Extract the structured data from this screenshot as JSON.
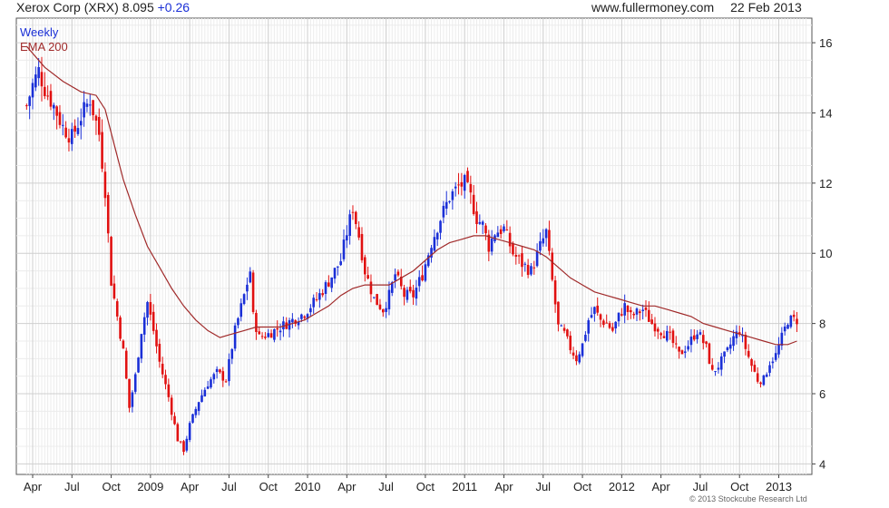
{
  "header": {
    "title": "Xerox Corp (XRX) 8.095",
    "change": "+0.26",
    "source": "www.fullermoney.com",
    "date": "22 Feb 2013"
  },
  "footer": {
    "copyright": "© 2013 Stockcube Research Ltd"
  },
  "colors": {
    "up": "#1a2fd6",
    "down": "#e01010",
    "ema": "#a02a2a",
    "grid": "#d4d4d4"
  },
  "chart_data": {
    "type": "line",
    "title": "Xerox Corp (XRX) 8.095 +0.26",
    "legend": [
      "Weekly",
      "EMA 200"
    ],
    "legend_position": "top-left",
    "grid": true,
    "y_axis_side": "right",
    "ylim": [
      3.7,
      16.7
    ],
    "y_ticks": [
      4,
      6,
      8,
      10,
      12,
      14,
      16
    ],
    "x_ticks": [
      {
        "label": "Apr",
        "w": 0
      },
      {
        "label": "Jul",
        "w": 13
      },
      {
        "label": "Oct",
        "w": 26
      },
      {
        "label": "2009",
        "w": 39
      },
      {
        "label": "Apr",
        "w": 52
      },
      {
        "label": "Jul",
        "w": 65
      },
      {
        "label": "Oct",
        "w": 78
      },
      {
        "label": "2010",
        "w": 91
      },
      {
        "label": "Apr",
        "w": 104
      },
      {
        "label": "Jul",
        "w": 117
      },
      {
        "label": "Oct",
        "w": 130
      },
      {
        "label": "2011",
        "w": 143
      },
      {
        "label": "Apr",
        "w": 156
      },
      {
        "label": "Jul",
        "w": 169
      },
      {
        "label": "Oct",
        "w": 182
      },
      {
        "label": "2012",
        "w": 195
      },
      {
        "label": "Apr",
        "w": 208
      },
      {
        "label": "Jul",
        "w": 221
      },
      {
        "label": "Oct",
        "w": 234
      },
      {
        "label": "2013",
        "w": 247
      }
    ],
    "weekly_close": [
      [
        -2,
        14.2
      ],
      [
        0,
        14.8
      ],
      [
        2,
        15.2
      ],
      [
        4,
        14.7
      ],
      [
        7,
        14.2
      ],
      [
        10,
        13.6
      ],
      [
        13,
        13.3
      ],
      [
        16,
        13.9
      ],
      [
        19,
        14.4
      ],
      [
        22,
        13.4
      ],
      [
        24,
        11.8
      ],
      [
        26,
        9.2
      ],
      [
        28,
        8.2
      ],
      [
        30,
        7.2
      ],
      [
        32,
        5.6
      ],
      [
        34,
        6.5
      ],
      [
        36,
        7.8
      ],
      [
        38,
        8.6
      ],
      [
        40,
        7.8
      ],
      [
        42,
        6.9
      ],
      [
        45,
        5.9
      ],
      [
        48,
        4.7
      ],
      [
        50,
        4.4
      ],
      [
        52,
        5.1
      ],
      [
        55,
        5.8
      ],
      [
        58,
        6.3
      ],
      [
        61,
        6.6
      ],
      [
        64,
        6.4
      ],
      [
        67,
        7.8
      ],
      [
        70,
        8.8
      ],
      [
        72,
        9.5
      ],
      [
        73,
        8.2
      ],
      [
        75,
        7.6
      ],
      [
        78,
        7.7
      ],
      [
        82,
        7.9
      ],
      [
        86,
        8.1
      ],
      [
        90,
        8.3
      ],
      [
        94,
        8.7
      ],
      [
        98,
        9.2
      ],
      [
        102,
        9.8
      ],
      [
        104,
        10.6
      ],
      [
        106,
        11.3
      ],
      [
        108,
        10.5
      ],
      [
        110,
        9.5
      ],
      [
        113,
        8.7
      ],
      [
        116,
        8.4
      ],
      [
        118,
        8.8
      ],
      [
        120,
        9.4
      ],
      [
        123,
        8.8
      ],
      [
        126,
        8.8
      ],
      [
        129,
        9.4
      ],
      [
        132,
        10.3
      ],
      [
        135,
        11.0
      ],
      [
        138,
        11.6
      ],
      [
        141,
        11.9
      ],
      [
        143,
        12.0
      ],
      [
        145,
        11.6
      ],
      [
        147,
        11.0
      ],
      [
        149,
        10.8
      ],
      [
        151,
        10.2
      ],
      [
        153,
        10.6
      ],
      [
        156,
        10.7
      ],
      [
        159,
        10.0
      ],
      [
        162,
        9.7
      ],
      [
        165,
        9.5
      ],
      [
        168,
        10.2
      ],
      [
        170,
        10.6
      ],
      [
        172,
        9.2
      ],
      [
        174,
        7.9
      ],
      [
        176,
        7.7
      ],
      [
        178,
        7.3
      ],
      [
        180,
        7.0
      ],
      [
        182,
        7.4
      ],
      [
        184,
        8.1
      ],
      [
        186,
        8.4
      ],
      [
        188,
        8.1
      ],
      [
        190,
        8.0
      ],
      [
        192,
        7.8
      ],
      [
        194,
        8.2
      ],
      [
        196,
        8.5
      ],
      [
        198,
        8.2
      ],
      [
        200,
        8.3
      ],
      [
        202,
        8.4
      ],
      [
        205,
        8.0
      ],
      [
        208,
        7.8
      ],
      [
        211,
        7.6
      ],
      [
        214,
        7.1
      ],
      [
        217,
        7.4
      ],
      [
        220,
        7.8
      ],
      [
        223,
        7.3
      ],
      [
        225,
        6.6
      ],
      [
        227,
        6.8
      ],
      [
        230,
        7.2
      ],
      [
        232,
        7.6
      ],
      [
        234,
        7.8
      ],
      [
        236,
        7.3
      ],
      [
        238,
        6.8
      ],
      [
        240,
        6.4
      ],
      [
        242,
        6.4
      ],
      [
        244,
        6.9
      ],
      [
        246,
        7.1
      ],
      [
        248,
        7.6
      ],
      [
        250,
        8.1
      ],
      [
        252,
        8.1
      ],
      [
        253,
        8.1
      ]
    ],
    "ema_200": [
      [
        -2,
        15.9
      ],
      [
        4,
        15.3
      ],
      [
        10,
        14.9
      ],
      [
        16,
        14.6
      ],
      [
        21,
        14.5
      ],
      [
        24,
        14.1
      ],
      [
        27,
        13.1
      ],
      [
        30,
        12.1
      ],
      [
        34,
        11.1
      ],
      [
        38,
        10.2
      ],
      [
        42,
        9.6
      ],
      [
        46,
        9.0
      ],
      [
        50,
        8.5
      ],
      [
        54,
        8.1
      ],
      [
        58,
        7.8
      ],
      [
        62,
        7.6
      ],
      [
        66,
        7.7
      ],
      [
        70,
        7.8
      ],
      [
        74,
        7.9
      ],
      [
        78,
        7.9
      ],
      [
        82,
        7.9
      ],
      [
        86,
        8.0
      ],
      [
        90,
        8.1
      ],
      [
        94,
        8.3
      ],
      [
        98,
        8.5
      ],
      [
        102,
        8.8
      ],
      [
        106,
        9.0
      ],
      [
        110,
        9.1
      ],
      [
        114,
        9.1
      ],
      [
        118,
        9.1
      ],
      [
        122,
        9.3
      ],
      [
        126,
        9.5
      ],
      [
        130,
        9.8
      ],
      [
        134,
        10.1
      ],
      [
        138,
        10.3
      ],
      [
        142,
        10.4
      ],
      [
        146,
        10.5
      ],
      [
        150,
        10.5
      ],
      [
        154,
        10.4
      ],
      [
        158,
        10.3
      ],
      [
        162,
        10.2
      ],
      [
        166,
        10.1
      ],
      [
        170,
        9.9
      ],
      [
        174,
        9.6
      ],
      [
        178,
        9.3
      ],
      [
        182,
        9.1
      ],
      [
        186,
        8.9
      ],
      [
        190,
        8.8
      ],
      [
        194,
        8.7
      ],
      [
        198,
        8.6
      ],
      [
        202,
        8.5
      ],
      [
        206,
        8.5
      ],
      [
        210,
        8.4
      ],
      [
        214,
        8.3
      ],
      [
        218,
        8.2
      ],
      [
        222,
        8.0
      ],
      [
        226,
        7.9
      ],
      [
        230,
        7.8
      ],
      [
        234,
        7.7
      ],
      [
        238,
        7.6
      ],
      [
        242,
        7.5
      ],
      [
        246,
        7.4
      ],
      [
        250,
        7.4
      ],
      [
        253,
        7.5
      ]
    ]
  }
}
